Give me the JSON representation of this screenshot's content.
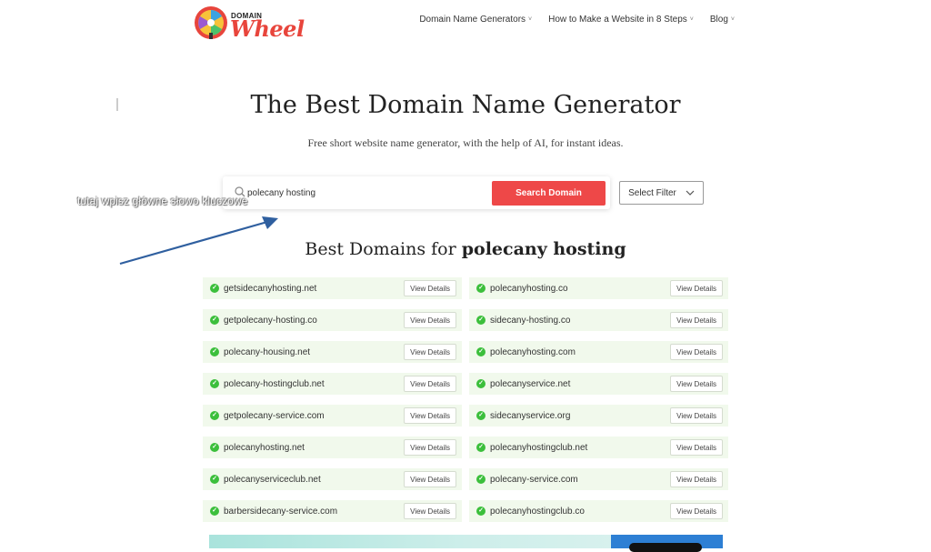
{
  "header": {
    "logo_top": "DOMAIN",
    "logo_main": "Wheel",
    "nav": [
      {
        "label": "Domain Name Generators"
      },
      {
        "label": "How to Make a Website in 8 Steps"
      },
      {
        "label": "Blog"
      }
    ]
  },
  "hero": {
    "title": "The Best Domain Name Generator",
    "subtitle": "Free short website name generator, with the help of AI, for instant ideas."
  },
  "search": {
    "value": "polecany hosting",
    "button_label": "Search Domain",
    "filter_label": "Select Filter"
  },
  "annotation": {
    "text": "tutaj wpisz główne słowo kluczowe"
  },
  "results": {
    "heading_prefix": "Best Domains for",
    "heading_keyword": "polecany hosting",
    "details_label": "View Details",
    "items": [
      {
        "domain": "getsidecanyhosting.net"
      },
      {
        "domain": "polecanyhosting.co"
      },
      {
        "domain": "getpolecany-hosting.co"
      },
      {
        "domain": "sidecany-hosting.co"
      },
      {
        "domain": "polecany-housing.net"
      },
      {
        "domain": "polecanyhosting.com"
      },
      {
        "domain": "polecany-hostingclub.net"
      },
      {
        "domain": "polecanyservice.net"
      },
      {
        "domain": "getpolecany-service.com"
      },
      {
        "domain": "sidecanyservice.org"
      },
      {
        "domain": "polecanyhosting.net"
      },
      {
        "domain": "polecanyhostingclub.net"
      },
      {
        "domain": "polecanyserviceclub.net"
      },
      {
        "domain": "polecany-service.com"
      },
      {
        "domain": "barbersidecany-service.com"
      },
      {
        "domain": "polecanyhostingclub.co"
      }
    ]
  },
  "colors": {
    "brand_red": "#ee4848",
    "check_green": "#3cbf3c",
    "row_bg": "#f1f9ec",
    "arrow_blue": "#2f5f9f"
  }
}
